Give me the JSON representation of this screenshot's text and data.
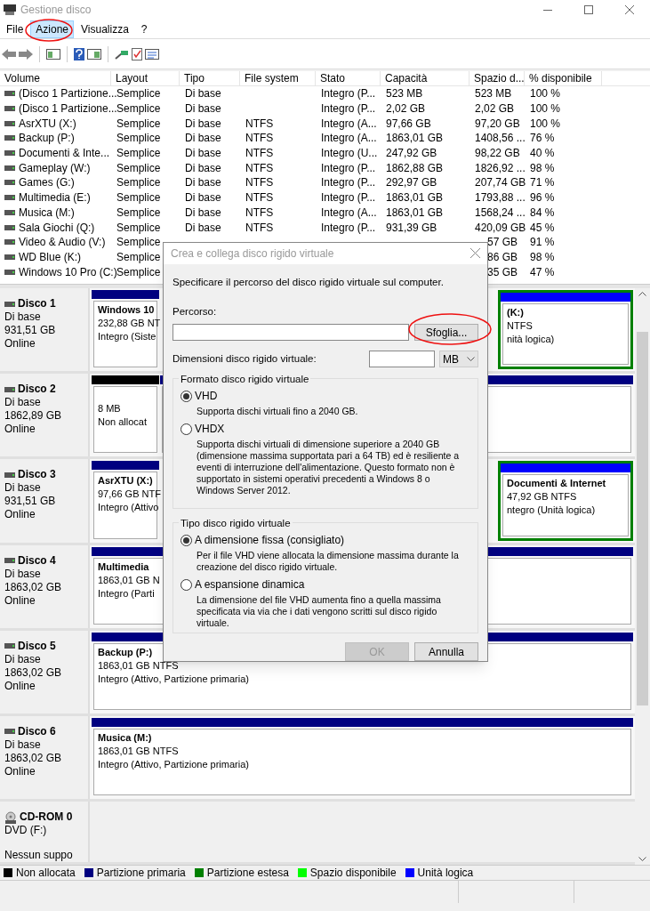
{
  "window": {
    "title": "Gestione disco"
  },
  "menu": [
    {
      "label": "File",
      "selected": false
    },
    {
      "label": "Azione",
      "selected": true
    },
    {
      "label": "Visualizza",
      "selected": false
    },
    {
      "label": "?",
      "selected": false
    }
  ],
  "table": {
    "columns": [
      "Volume",
      "Layout",
      "Tipo",
      "File system",
      "Stato",
      "Capacità",
      "Spazio d...",
      "% disponibile"
    ],
    "rows": [
      [
        "(Disco 1 Partizione...",
        "Semplice",
        "Di base",
        null,
        "Integro (P...",
        "523 MB",
        "523 MB",
        "100 %"
      ],
      [
        "(Disco 1 Partizione...",
        "Semplice",
        "Di base",
        null,
        "Integro (P...",
        "2,02 GB",
        "2,02 GB",
        "100 %"
      ],
      [
        "AsrXTU (X:)",
        "Semplice",
        "Di base",
        "NTFS",
        "Integro (A...",
        "97,66 GB",
        "97,20 GB",
        "100 %"
      ],
      [
        "Backup (P:)",
        "Semplice",
        "Di base",
        "NTFS",
        "Integro (A...",
        "1863,01 GB",
        "1408,56 ...",
        "76 %"
      ],
      [
        "Documenti & Inte...",
        "Semplice",
        "Di base",
        "NTFS",
        "Integro (U...",
        "247,92 GB",
        "98,22 GB",
        "40 %"
      ],
      [
        "Gameplay (W:)",
        "Semplice",
        "Di base",
        "NTFS",
        "Integro (P...",
        "1862,88 GB",
        "1826,92 ...",
        "98 %"
      ],
      [
        "Games (G:)",
        "Semplice",
        "Di base",
        "NTFS",
        "Integro (P...",
        "292,97 GB",
        "207,74 GB",
        "71 %"
      ],
      [
        "Multimedia (E:)",
        "Semplice",
        "Di base",
        "NTFS",
        "Integro (P...",
        "1863,01 GB",
        "1793,88 ...",
        "96 %"
      ],
      [
        "Musica (M:)",
        "Semplice",
        "Di base",
        "NTFS",
        "Integro (A...",
        "1863,01 GB",
        "1568,24 ...",
        "84 %"
      ],
      [
        "Sala Giochi (Q:)",
        "Semplice",
        "Di base",
        "NTFS",
        "Integro (P...",
        "931,39 GB",
        "420,09 GB",
        "45 %"
      ],
      [
        "Video & Audio (V:)",
        "Semplice",
        null,
        null,
        null,
        null,
        "57 GB",
        "91 %"
      ],
      [
        "WD Blue (K:)",
        "Semplice",
        null,
        null,
        null,
        null,
        "86 GB",
        "98 %"
      ],
      [
        "Windows 10 Pro (C:)",
        "Semplice",
        null,
        null,
        null,
        null,
        "35 GB",
        "47 %"
      ]
    ]
  },
  "disks": [
    {
      "kind": "disk",
      "name": "Disco 1",
      "lines": [
        "Di base",
        "931,51 GB",
        "Online"
      ],
      "partitions": [
        {
          "kind": "primary",
          "title": "Windows 10",
          "lines": [
            "232,88 GB NT",
            "Integro (Siste"
          ]
        },
        {
          "kind": "logical",
          "title": "(K:)",
          "lines": [
            "NTFS",
            "nità logica)"
          ]
        }
      ]
    },
    {
      "kind": "disk",
      "name": "Disco 2",
      "lines": [
        "Di base",
        "1862,89 GB",
        "Online"
      ],
      "partitions": [
        {
          "kind": "unallocated",
          "lines": [
            "8 MB",
            "Non allocat"
          ]
        },
        {
          "kind": "primary"
        }
      ]
    },
    {
      "kind": "disk",
      "name": "Disco 3",
      "lines": [
        "Di base",
        "931,51 GB",
        "Online"
      ],
      "partitions": [
        {
          "kind": "primary",
          "title": "AsrXTU  (X:)",
          "lines": [
            "97,66 GB NTF",
            "Integro (Attivo"
          ]
        },
        {
          "kind": "logical",
          "title": "Documenti & Internet",
          "lines": [
            "47,92 GB NTFS",
            "ntegro (Unità logica)"
          ]
        }
      ]
    },
    {
      "kind": "disk",
      "name": "Disco 4",
      "lines": [
        "Di base",
        "1863,02 GB",
        "Online"
      ],
      "partitions": [
        {
          "kind": "primary",
          "title": "Multimedia",
          "lines": [
            "1863,01 GB N",
            "Integro (Parti"
          ]
        }
      ]
    },
    {
      "kind": "disk",
      "name": "Disco 5",
      "lines": [
        "Di base",
        "1863,02 GB",
        "Online"
      ],
      "partitions": [
        {
          "kind": "primary",
          "title": "Backup  (P:)",
          "lines": [
            "1863,01 GB NTFS",
            "Integro (Attivo, Partizione primaria)"
          ]
        }
      ]
    },
    {
      "kind": "disk",
      "name": "Disco 6",
      "lines": [
        "Di base",
        "1863,02 GB",
        "Online"
      ],
      "partitions": [
        {
          "kind": "primary",
          "title": "Musica  (M:)",
          "lines": [
            "1863,01 GB NTFS",
            "Integro (Attivo, Partizione primaria)"
          ]
        }
      ]
    },
    {
      "kind": "cdrom",
      "name": "CD-ROM 0",
      "lines": [
        "DVD (F:)",
        "Nessun suppo"
      ]
    }
  ],
  "legend": [
    {
      "label": "Non allocata",
      "color": "#000000"
    },
    {
      "label": "Partizione primaria",
      "color": "#000080"
    },
    {
      "label": "Partizione estesa",
      "color": "#008000"
    },
    {
      "label": "Spazio disponibile",
      "color": "#00ff00"
    },
    {
      "label": "Unità logica",
      "color": "#0000ff"
    }
  ],
  "dialog": {
    "title": "Crea e collega disco rigido virtuale",
    "intro": "Specificare il percorso del disco rigido virtuale sul computer.",
    "path_label": "Percorso:",
    "browse_button": "Sfoglia...",
    "size_label": "Dimensioni disco rigido virtuale:",
    "unit": "MB",
    "groups": [
      {
        "title": "Formato disco rigido virtuale",
        "options": [
          {
            "label": "VHD",
            "description": "Supporta dischi virtuali fino a 2040 GB.",
            "selected": true
          },
          {
            "label": "VHDX",
            "description": "Supporta dischi virtuali di dimensione superiore a 2040 GB (dimensione massima supportata pari a 64 TB) ed è resiliente a eventi di interruzione dell'alimentazione. Questo formato non è supportato in sistemi operativi precedenti a Windows 8 o Windows Server 2012.",
            "selected": false
          }
        ]
      },
      {
        "title": "Tipo disco rigido virtuale",
        "options": [
          {
            "label": "A dimensione fissa (consigliato)",
            "description": "Per il file VHD viene allocata la dimensione massima durante la creazione del disco rigido virtuale.",
            "selected": true
          },
          {
            "label": "A espansione dinamica",
            "description": "La dimensione del file VHD aumenta fino a quella massima specificata via via che i dati vengono scritti sul disco rigido virtuale.",
            "selected": false
          }
        ]
      }
    ],
    "buttons": [
      {
        "label": "OK",
        "disabled": true
      },
      {
        "label": "Annulla",
        "disabled": false
      }
    ]
  }
}
